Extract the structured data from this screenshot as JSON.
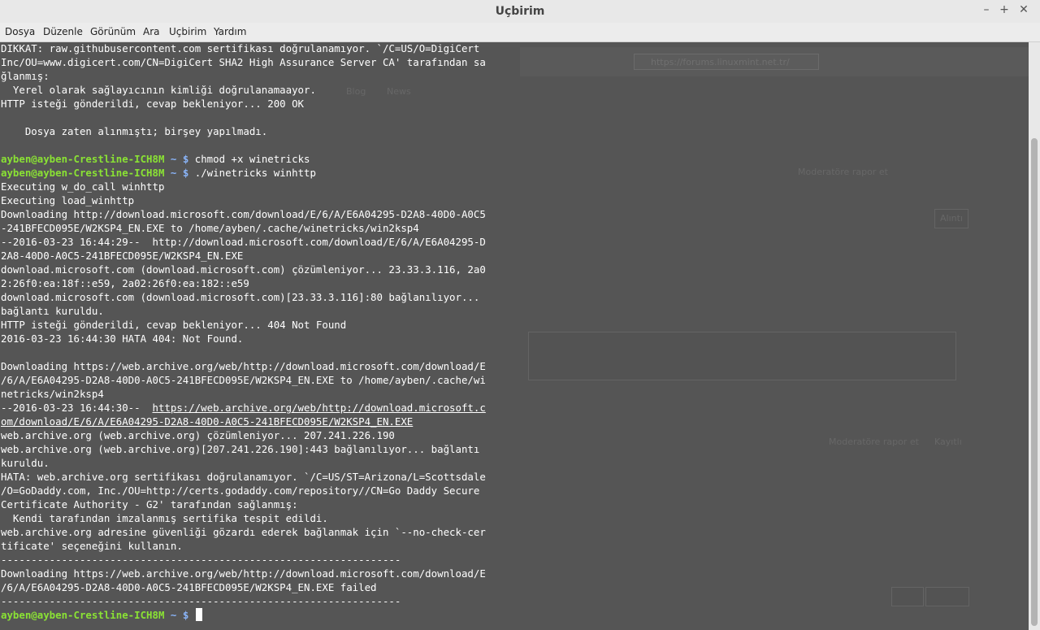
{
  "window": {
    "title": "Uçbirim"
  },
  "menu": [
    "Dosya",
    "Düzenle",
    "Görünüm",
    "Ara",
    "Uçbirim",
    "Yardım"
  ],
  "prompt": {
    "user_host": "ayben@ayben-Crestline-ICH8M",
    "dir": "~",
    "symbol": "$"
  },
  "commands": {
    "c1": "chmod +x winetricks",
    "c2": "./winetricks winhttp",
    "c3": ""
  },
  "background": {
    "url": "https://forums.linuxmint.net.tr/",
    "t1": "Blog",
    "t2": "News",
    "t3": "Moderatöre rapor et",
    "t4": "Alıntı",
    "t5": "Moderatöre rapor et",
    "t6": "Kayıtlı"
  },
  "lines": {
    "l01": "DIKKAT: raw.githubusercontent.com sertifikası doğrulanamıyor. `/C=US/O=DigiCert",
    "l02": "Inc/OU=www.digicert.com/CN=DigiCert SHA2 High Assurance Server CA' tarafından sa",
    "l03": "ğlanmış:",
    "l04": "  Yerel olarak sağlayıcının kimliği doğrulanamaayor.",
    "l05": "HTTP isteği gönderildi, cevap bekleniyor... 200 OK",
    "l06": "",
    "l07": "    Dosya zaten alınmıştı; birşey yapılmadı.",
    "l08": "",
    "l11": "Executing w_do_call winhttp",
    "l12": "Executing load_winhttp",
    "l13": "Downloading http://download.microsoft.com/download/E/6/A/E6A04295-D2A8-40D0-A0C5",
    "l14": "-241BFECD095E/W2KSP4_EN.EXE to /home/ayben/.cache/winetricks/win2ksp4",
    "l15": "--2016-03-23 16:44:29--  http://download.microsoft.com/download/E/6/A/E6A04295-D",
    "l16": "2A8-40D0-A0C5-241BFECD095E/W2KSP4_EN.EXE",
    "l17": "download.microsoft.com (download.microsoft.com) çözümleniyor... 23.33.3.116, 2a0",
    "l18": "2:26f0:ea:18f::e59, 2a02:26f0:ea:182::e59",
    "l19": "download.microsoft.com (download.microsoft.com)[23.33.3.116]:80 bağlanılıyor...",
    "l20": "bağlantı kuruldu.",
    "l21": "HTTP isteği gönderildi, cevap bekleniyor... 404 Not Found",
    "l22": "2016-03-23 16:44:30 HATA 404: Not Found.",
    "l23": "",
    "l24": "Downloading https://web.archive.org/web/http://download.microsoft.com/download/E",
    "l25": "/6/A/E6A04295-D2A8-40D0-A0C5-241BFECD095E/W2KSP4_EN.EXE to /home/ayben/.cache/wi",
    "l26": "netricks/win2ksp4",
    "l27a": "--2016-03-23 16:44:30--  ",
    "l27b": "https://web.archive.org/web/http://download.microsoft.c",
    "l28": "om/download/E/6/A/E6A04295-D2A8-40D0-A0C5-241BFECD095E/W2KSP4_EN.EXE",
    "l29": "web.archive.org (web.archive.org) çözümleniyor... 207.241.226.190",
    "l30": "web.archive.org (web.archive.org)[207.241.226.190]:443 bağlanılıyor... bağlantı",
    "l31": "kuruldu.",
    "l32": "HATA: web.archive.org sertifikası doğrulanamıyor. `/C=US/ST=Arizona/L=Scottsdale",
    "l33": "/O=GoDaddy.com, Inc./OU=http://certs.godaddy.com/repository//CN=Go Daddy Secure",
    "l34": "Certificate Authority - G2' tarafından sağlanmış:",
    "l35": "  Kendi tarafından imzalanmış sertifika tespit edildi.",
    "l36": "web.archive.org adresine güvenliği gözardı ederek bağlanmak için `--no-check-cer",
    "l37": "tificate' seçeneğini kullanın.",
    "l38": "------------------------------------------------------------------",
    "l39": "Downloading https://web.archive.org/web/http://download.microsoft.com/download/E",
    "l40": "/6/A/E6A04295-D2A8-40D0-A0C5-241BFECD095E/W2KSP4_EN.EXE failed",
    "l41": "------------------------------------------------------------------"
  }
}
